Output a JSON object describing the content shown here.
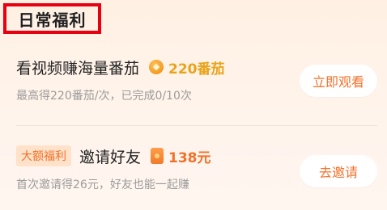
{
  "section": {
    "title": "日常福利"
  },
  "tasks": [
    {
      "title": "看视频赚海量番茄",
      "reward": "220番茄",
      "reward_icon": "coin-icon",
      "subtitle": "最高得220番茄/次，已完成0/10次",
      "button": "立即观看"
    },
    {
      "tag": "大额福利",
      "title": "邀请好友",
      "reward": "138元",
      "reward_icon": "red-envelope-icon",
      "subtitle": "首次邀请得26元，好友也能一起赚",
      "button": "去邀请"
    }
  ],
  "colors": {
    "accent": "#f3722c",
    "coin": "#e9a31b",
    "highlight_border": "#e60012"
  }
}
